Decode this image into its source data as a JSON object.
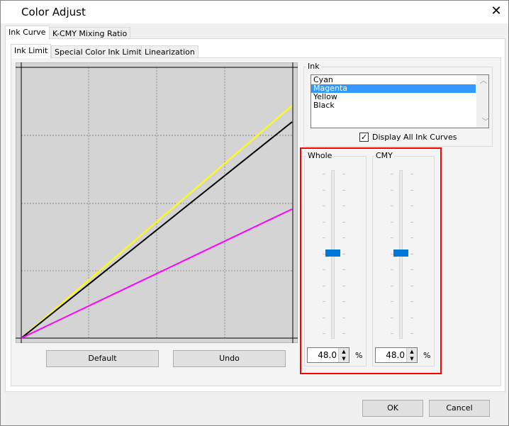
{
  "window": {
    "title": "Color Adjust",
    "close_icon": "close-icon"
  },
  "outer_tabs": [
    {
      "label": "Ink Curve",
      "active": true
    },
    {
      "label": "K-CMY Mixing Ratio",
      "active": false
    }
  ],
  "inner_tabs": [
    {
      "label": "Ink Limit",
      "active": true
    },
    {
      "label": "Special Color Ink Limit",
      "active": false
    },
    {
      "label": "Linearization",
      "active": false
    }
  ],
  "curve": {
    "colors": {
      "background": "#d4d4d4",
      "yellow": "#ffff00",
      "black": "#000000",
      "magenta": "#ff00ff"
    }
  },
  "buttons": {
    "default": "Default",
    "undo": "Undo",
    "ok": "OK",
    "cancel": "Cancel"
  },
  "ink": {
    "label": "Ink",
    "items": [
      "Cyan",
      "Magenta",
      "Yellow",
      "Black"
    ],
    "selected": "Magenta",
    "selection_color": "#3399ff",
    "display_all_label": "Display All Ink Curves",
    "display_all_checked": true
  },
  "sliders": [
    {
      "label": "Whole",
      "value": "48.0",
      "unit": "%",
      "level_percent": 48
    },
    {
      "label": "CMY",
      "value": "48.0",
      "unit": "%",
      "level_percent": 48
    }
  ],
  "highlight_color": "#ff0000"
}
